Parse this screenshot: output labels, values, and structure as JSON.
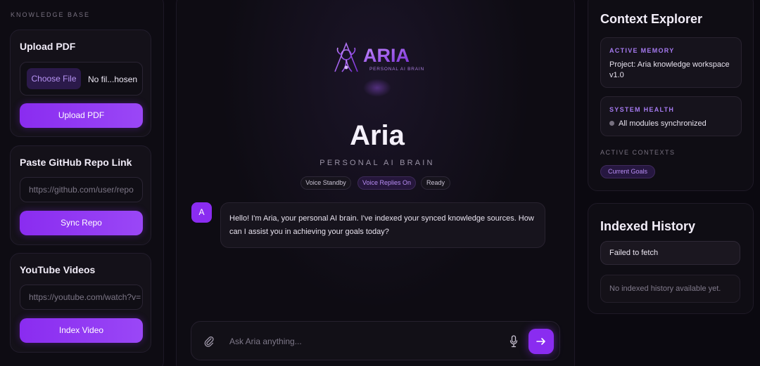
{
  "knowledge_base": {
    "title": "KNOWLEDGE BASE",
    "upload_pdf": {
      "title": "Upload PDF",
      "choose_file_label": "Choose File",
      "file_name": "No fil...hosen",
      "button_label": "Upload PDF"
    },
    "github": {
      "title": "Paste GitHub Repo Link",
      "placeholder": "https://github.com/user/repo",
      "button_label": "Sync Repo"
    },
    "youtube": {
      "title": "YouTube Videos",
      "placeholder": "https://youtube.com/watch?v=",
      "button_label": "Index Video"
    }
  },
  "center": {
    "logo_text": "ARIA",
    "logo_subtitle": "PERSONAL AI BRAIN",
    "title": "Aria",
    "subtitle": "PERSONAL AI BRAIN",
    "status_pills": [
      {
        "label": "Voice Standby"
      },
      {
        "label": "Voice Replies On"
      },
      {
        "label": "Ready"
      }
    ],
    "message": {
      "avatar_letter": "A",
      "text": "Hello! I'm Aria, your personal AI brain. I've indexed your synced knowledge sources. How can I assist you in achieving your goals today?"
    },
    "composer": {
      "placeholder": "Ask Aria anything..."
    }
  },
  "context_explorer": {
    "title": "Context Explorer",
    "active_memory": {
      "label": "ACTIVE MEMORY",
      "text": "Project: Aria knowledge workspace v1.0"
    },
    "system_health": {
      "label": "SYSTEM HEALTH",
      "text": "All modules synchronized"
    },
    "active_contexts_label": "ACTIVE CONTEXTS",
    "context_chip": "Current Goals"
  },
  "indexed_history": {
    "title": "Indexed History",
    "error_text": "Failed to fetch",
    "empty_text": "No indexed history available yet."
  },
  "colors": {
    "accent": "#8a2cf0",
    "accent_text": "#b88df4",
    "background": "#0b0910"
  }
}
